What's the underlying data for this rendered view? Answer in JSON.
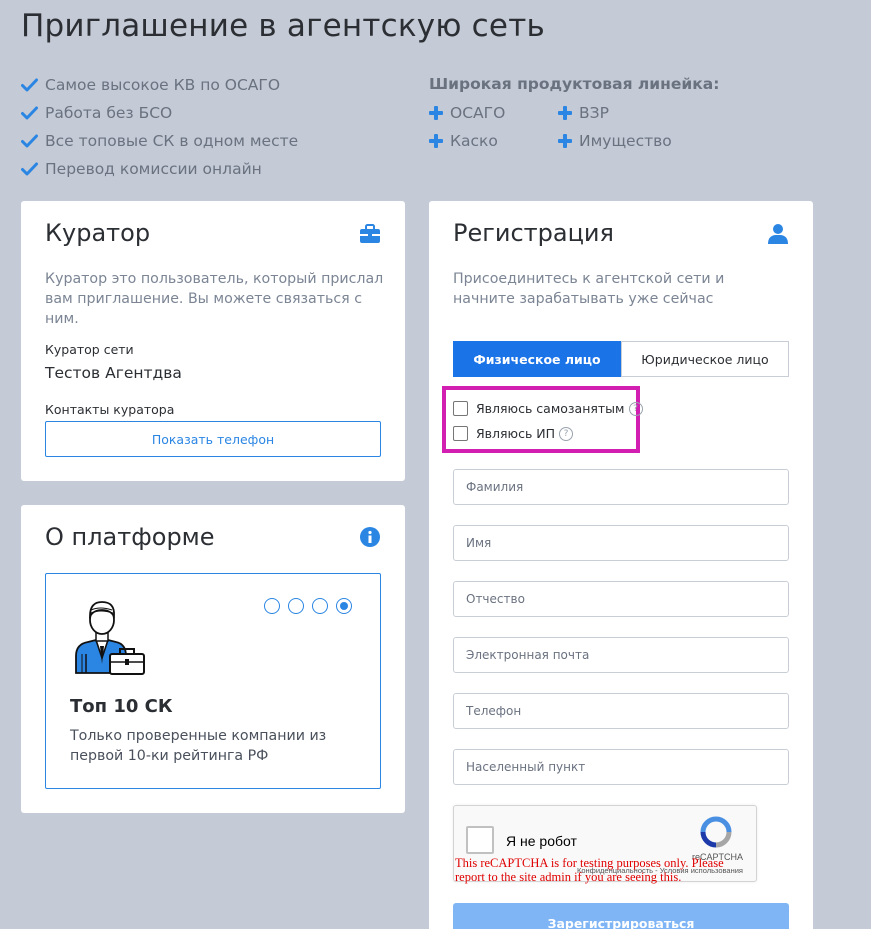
{
  "page_title": "Приглашение в агентскую сеть",
  "benefits": [
    "Самое высокое КВ по ОСАГО",
    "Работа без БСО",
    "Все топовые СК в одном месте",
    "Перевод комиссии онлайн"
  ],
  "products": {
    "title": "Широкая продуктовая линейка:",
    "items": [
      "ОСАГО",
      "ВЗР",
      "Каско",
      "Имущество"
    ]
  },
  "curator": {
    "title": "Куратор",
    "description": "Куратор это пользователь, который прислал вам приглашение. Вы можете связаться с ним.",
    "network_label": "Куратор сети",
    "network_value": "Тестов Агентдва",
    "contacts_label": "Контакты куратора",
    "show_phone_button": "Показать телефон"
  },
  "platform": {
    "title": "О платформе",
    "slide_title": "Топ 10 СК",
    "slide_text": "Только проверенные компании из первой 10-ки рейтинга РФ",
    "active_slide": 4,
    "slide_count": 4
  },
  "registration": {
    "title": "Регистрация",
    "description": "Присоединитесь к агентской сети и начните зарабатывать уже сейчас",
    "tabs": [
      "Физическое лицо",
      "Юридическое лицо"
    ],
    "active_tab": 0,
    "checkboxes": [
      "Являюсь самозанятым",
      "Являюсь ИП"
    ],
    "help_glyph": "?",
    "fields": [
      "Фамилия",
      "Имя",
      "Отчество",
      "Электронная почта",
      "Телефон",
      "Населенный пункт"
    ],
    "submit_label": "Зарегистрироваться"
  },
  "recaptcha": {
    "label": "Я не робот",
    "brand": "reCAPTCHA",
    "terms": "Конфиденциальность - Условия использования",
    "warning": "This reCAPTCHA is for testing purposes only. Please report to the site admin if you are seeing this."
  },
  "colors": {
    "accent": "#2b86e3",
    "primary_button": "#1b73e8",
    "highlight_border": "#d31eb2",
    "background": "#c4cad6",
    "warning_text": "#e00000"
  }
}
